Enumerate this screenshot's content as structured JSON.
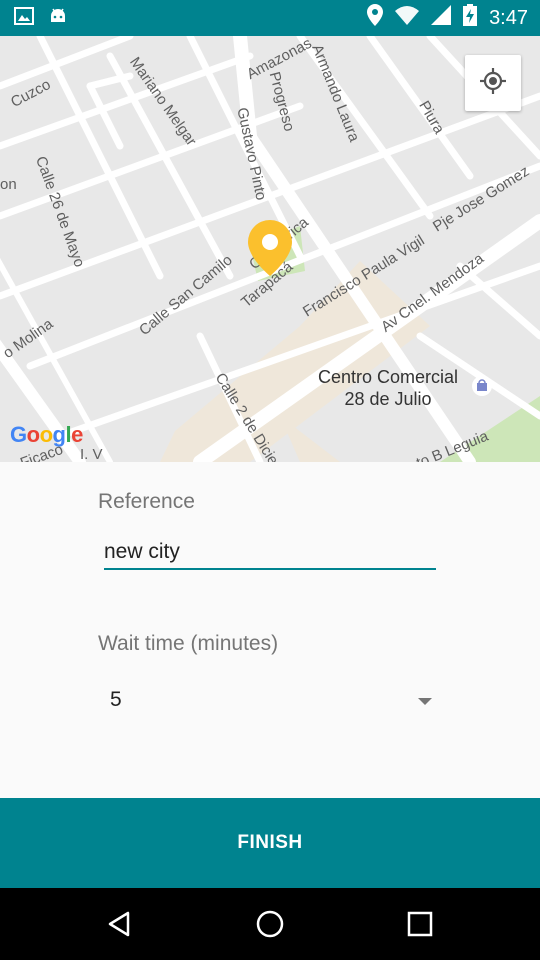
{
  "status_bar": {
    "time": "3:47",
    "icons": [
      "image-icon",
      "android-icon",
      "location-icon",
      "wifi-icon",
      "signal-icon",
      "battery-charging-icon"
    ]
  },
  "map": {
    "streets": [
      {
        "name": "Cuzco"
      },
      {
        "name": "Mariano Melgar"
      },
      {
        "name": "Amazonas"
      },
      {
        "name": "Progreso"
      },
      {
        "name": "Armando Laura"
      },
      {
        "name": "Piura"
      },
      {
        "name": "Gustavo Pinto"
      },
      {
        "name": "Calle 26 de Mayo"
      },
      {
        "name": "Pje Jose Gomez"
      },
      {
        "name": "Francisco Paula Vigil"
      },
      {
        "name": "Calle San Camilo"
      },
      {
        "name": "Calle Arica"
      },
      {
        "name": "Tarapacá"
      },
      {
        "name": "Av Cnel. Mendoza"
      },
      {
        "name": "o Molina"
      },
      {
        "name": "Calle 2 de Diciem"
      },
      {
        "name": "to B Leguia"
      },
      {
        "name": "on"
      },
      {
        "name": "Ficaco"
      },
      {
        "name": "I. V"
      }
    ],
    "poi": {
      "line1": "Centro Comercial",
      "line2": "28 de Julio"
    },
    "google_logo": "Google",
    "locate_button_icon": "my-location-icon",
    "marker_icon": "map-marker-icon",
    "marker_color": "#fbc02d"
  },
  "form": {
    "reference_label": "Reference",
    "reference_value": "new city",
    "wait_label": "Wait time (minutes)",
    "wait_value": "5"
  },
  "finish_button": "FINISH",
  "colors": {
    "primary": "#00838f",
    "background": "#fafafa"
  },
  "nav_bar": {
    "icons": [
      "back-icon",
      "home-icon",
      "recents-icon"
    ]
  }
}
